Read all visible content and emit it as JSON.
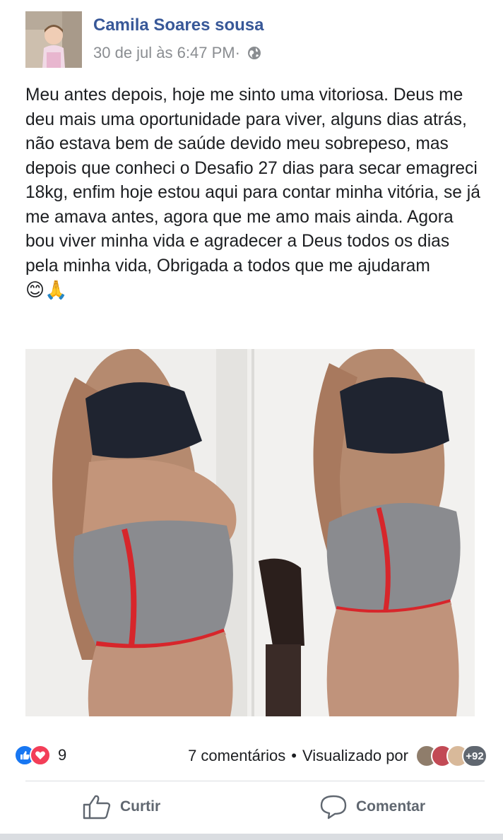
{
  "post": {
    "author": "Camila Soares sousa",
    "timestamp": "30 de jul às 6:47 PM·",
    "privacy_icon": "globe-icon",
    "text": "Meu antes depois, hoje me sinto uma vitoriosa. Deus me deu mais uma oportunidade para viver, alguns dias atrás, não estava bem de saúde devido meu sobrepeso, mas depois que conheci o Desafio 27 dias para secar emagreci 18kg, enfim hoje estou aqui para contar minha vitória, se já me amava antes, agora que me amo mais ainda. Agora bou viver minha vida e agradecer a Deus todos os dias pela minha vida, Obrigada a todos que me ajudaram",
    "emoji": "😊🙏"
  },
  "stats": {
    "reaction_count": "9",
    "comments": "7 comentários",
    "separator": "•",
    "viewed_by": "Visualizado por",
    "viewers_more": "+92"
  },
  "actions": {
    "like_label": "Curtir",
    "comment_label": "Comentar"
  },
  "colors": {
    "author": "#385898",
    "like": "#1877f2",
    "love": "#f33e58",
    "muted": "#606770"
  }
}
